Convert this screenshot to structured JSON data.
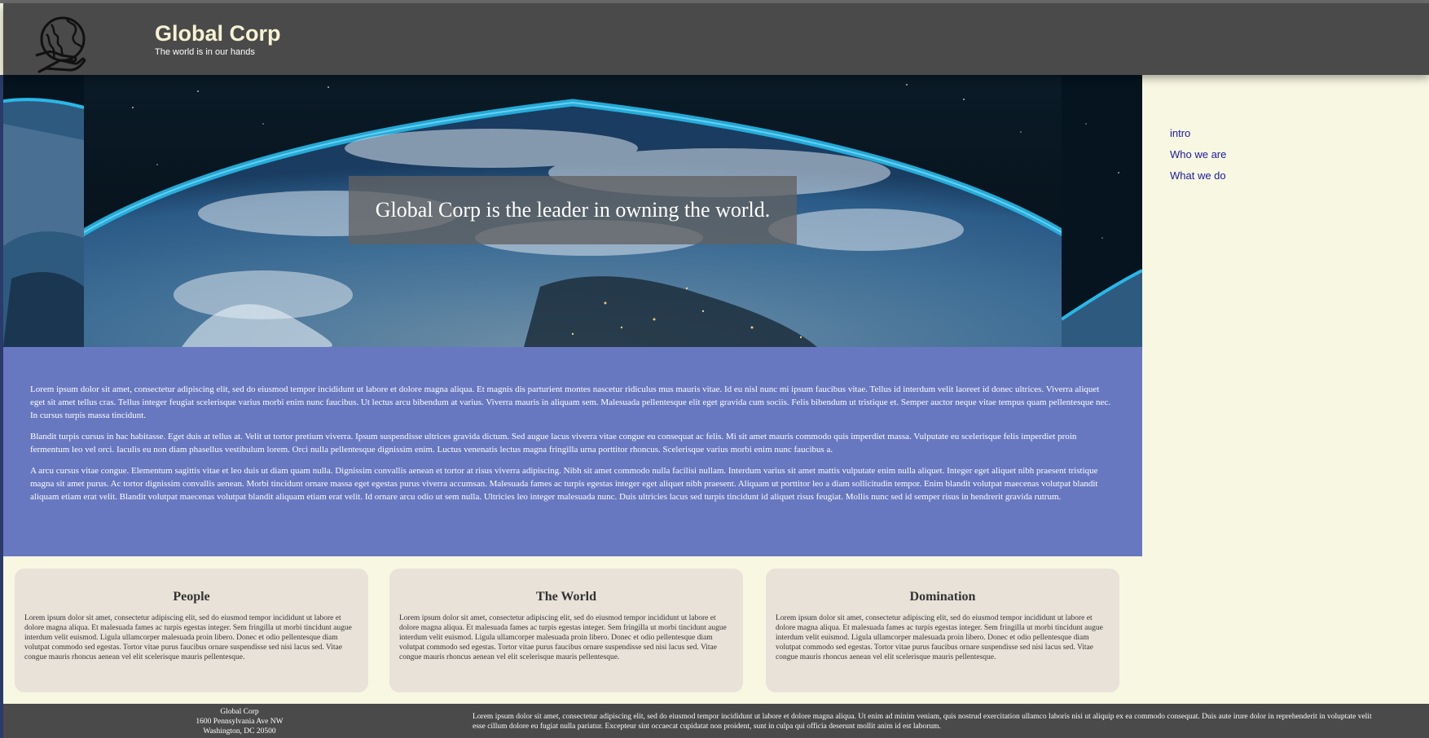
{
  "header": {
    "title": "Global Corp",
    "tagline": "The world is in our hands",
    "logo_icon": "globe-in-hand-icon"
  },
  "hero": {
    "caption": "Global Corp is the leader in owning the world."
  },
  "nav": {
    "items": [
      {
        "label": "intro"
      },
      {
        "label": "Who we are"
      },
      {
        "label": "What we do"
      }
    ]
  },
  "intro": {
    "paragraphs": [
      "Lorem ipsum dolor sit amet, consectetur adipiscing elit, sed do eiusmod tempor incididunt ut labore et dolore magna aliqua. Et magnis dis parturient montes nascetur ridiculus mus mauris vitae. Id eu nisl nunc mi ipsum faucibus vitae. Tellus id interdum velit laoreet id donec ultrices. Viverra aliquet eget sit amet tellus cras. Tellus integer feugiat scelerisque varius morbi enim nunc faucibus. Ut lectus arcu bibendum at varius. Viverra mauris in aliquam sem. Malesuada pellentesque elit eget gravida cum sociis. Felis bibendum ut tristique et. Semper auctor neque vitae tempus quam pellentesque nec. In cursus turpis massa tincidunt.",
      "Blandit turpis cursus in hac habitasse. Eget duis at tellus at. Velit ut tortor pretium viverra. Ipsum suspendisse ultrices gravida dictum. Sed augue lacus viverra vitae congue eu consequat ac felis. Mi sit amet mauris commodo quis imperdiet massa. Vulputate eu scelerisque felis imperdiet proin fermentum leo vel orci. Iaculis eu non diam phasellus vestibulum lorem. Orci nulla pellentesque dignissim enim. Luctus venenatis lectus magna fringilla urna porttitor rhoncus. Scelerisque varius morbi enim nunc faucibus a.",
      "A arcu cursus vitae congue. Elementum sagittis vitae et leo duis ut diam quam nulla. Dignissim convallis aenean et tortor at risus viverra adipiscing. Nibh sit amet commodo nulla facilisi nullam. Interdum varius sit amet mattis vulputate enim nulla aliquet. Integer eget aliquet nibh praesent tristique magna sit amet purus. Ac tortor dignissim convallis aenean. Morbi tincidunt ornare massa eget egestas purus viverra accumsan. Malesuada fames ac turpis egestas integer eget aliquet nibh praesent. Aliquam ut porttitor leo a diam sollicitudin tempor. Enim blandit volutpat maecenas volutpat blandit aliquam etiam erat velit. Blandit volutpat maecenas volutpat blandit aliquam etiam erat velit. Id ornare arcu odio ut sem nulla. Ultricies leo integer malesuada nunc. Duis ultricies lacus sed turpis tincidunt id aliquet risus feugiat. Mollis nunc sed id semper risus in hendrerit gravida rutrum."
    ]
  },
  "cards": [
    {
      "title": "People",
      "text": "Lorem ipsum dolor sit amet, consectetur adipiscing elit, sed do eiusmod tempor incididunt ut labore et dolore magna aliqua. Et malesuada fames ac turpis egestas integer. Sem fringilla ut morbi tincidunt augue interdum velit euismod. Ligula ullamcorper malesuada proin libero. Donec et odio pellentesque diam volutpat commodo sed egestas. Tortor vitae purus faucibus ornare suspendisse sed nisi lacus sed. Vitae congue mauris rhoncus aenean vel elit scelerisque mauris pellentesque."
    },
    {
      "title": "The World",
      "text": "Lorem ipsum dolor sit amet, consectetur adipiscing elit, sed do eiusmod tempor incididunt ut labore et dolore magna aliqua. Et malesuada fames ac turpis egestas integer. Sem fringilla ut morbi tincidunt augue interdum velit euismod. Ligula ullamcorper malesuada proin libero. Donec et odio pellentesque diam volutpat commodo sed egestas. Tortor vitae purus faucibus ornare suspendisse sed nisi lacus sed. Vitae congue mauris rhoncus aenean vel elit scelerisque mauris pellentesque."
    },
    {
      "title": "Domination",
      "text": "Lorem ipsum dolor sit amet, consectetur adipiscing elit, sed do eiusmod tempor incididunt ut labore et dolore magna aliqua. Et malesuada fames ac turpis egestas integer. Sem fringilla ut morbi tincidunt augue interdum velit euismod. Ligula ullamcorper malesuada proin libero. Donec et odio pellentesque diam volutpat commodo sed egestas. Tortor vitae purus faucibus ornare suspendisse sed nisi lacus sed. Vitae congue mauris rhoncus aenean vel elit scelerisque mauris pellentesque."
    }
  ],
  "footer": {
    "address": {
      "name": "Global Corp",
      "street": "1600 Pennsylvania Ave NW",
      "city": "Washington, DC 20500"
    },
    "text": "Lorem ipsum dolor sit amet, consectetur adipiscing elit, sed do eiusmod tempor incididunt ut labore et dolore magna aliqua. Ut enim ad minim veniam, quis nostrud exercitation ullamco laboris nisi ut aliquip ex ea commodo consequat. Duis aute irure dolor in reprehenderit in voluptate velit esse cillum dolore eu fugiat nulla pariatur. Excepteur sint occaecat cupidatat non proident, sunt in culpa qui officia deserunt mollit anim id est laborum."
  },
  "colors": {
    "header_bg": "#4a4a4a",
    "brand_title": "#f7f2d2",
    "page_bg": "#f8f7e2",
    "intro_bg": "#6878c0",
    "card_bg": "#e8e2d8",
    "nav_link": "#1a1aa0",
    "earth_glow": "#28b8e8"
  }
}
